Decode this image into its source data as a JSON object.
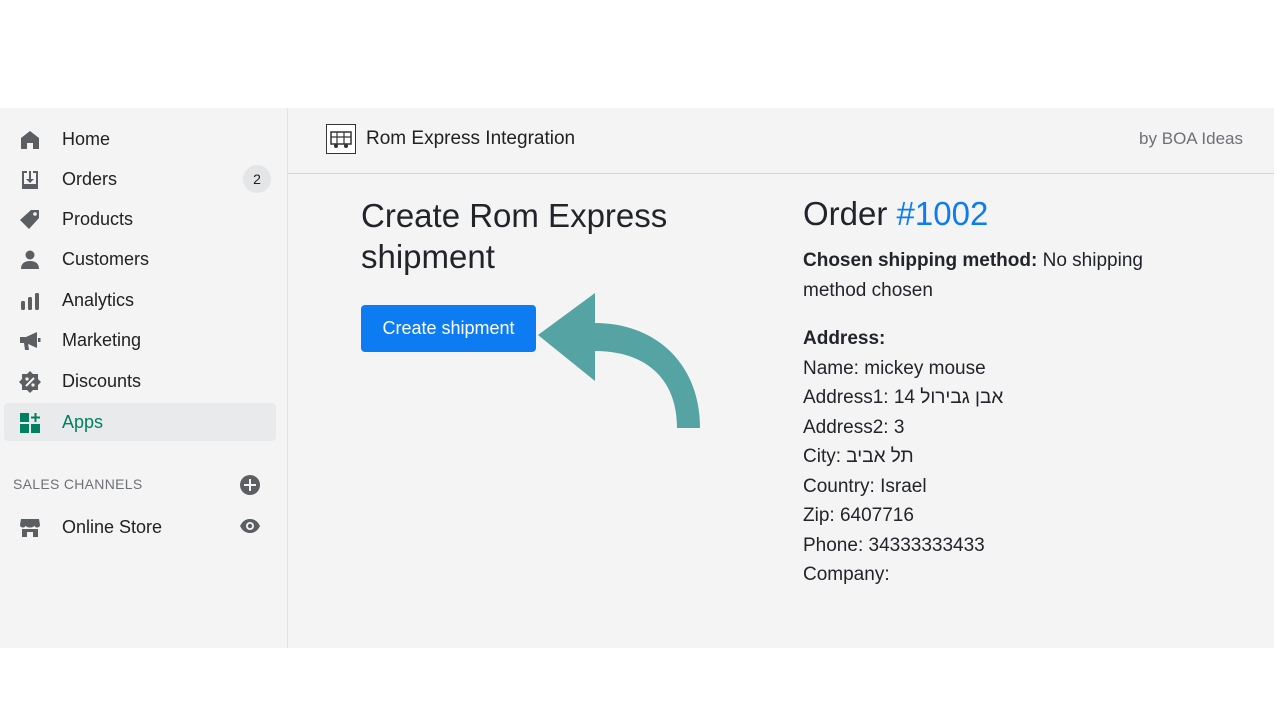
{
  "sidebar": {
    "items": [
      {
        "label": "Home",
        "icon": "home-icon"
      },
      {
        "label": "Orders",
        "icon": "orders-icon",
        "badge": "2"
      },
      {
        "label": "Products",
        "icon": "tag-icon"
      },
      {
        "label": "Customers",
        "icon": "person-icon"
      },
      {
        "label": "Analytics",
        "icon": "bar-chart-icon"
      },
      {
        "label": "Marketing",
        "icon": "megaphone-icon"
      },
      {
        "label": "Discounts",
        "icon": "discount-icon"
      },
      {
        "label": "Apps",
        "icon": "apps-icon",
        "active": true
      }
    ],
    "sales_channels_title": "SALES CHANNELS",
    "online_store_label": "Online Store"
  },
  "app": {
    "title": "Rom Express Integration",
    "by": "by BOA Ideas"
  },
  "main": {
    "heading": "Create Rom Express shipment",
    "button_label": "Create shipment",
    "order_prefix": "Order",
    "order_number": "#1002",
    "shipping_method_label": "Chosen shipping method:",
    "shipping_method_value": "No shipping method chosen",
    "address_title": "Address:",
    "address_lines": [
      "Name: mickey mouse",
      "Address1: 14 אבן גבירול",
      "Address2: 3",
      "City: תל אביב",
      "Country: Israel",
      "Zip: 6407716",
      "Phone: 34333333433",
      "Company:"
    ]
  },
  "colors": {
    "accent": "#0d7cf2",
    "active_nav": "#008060",
    "arrow": "#55a3a3"
  }
}
